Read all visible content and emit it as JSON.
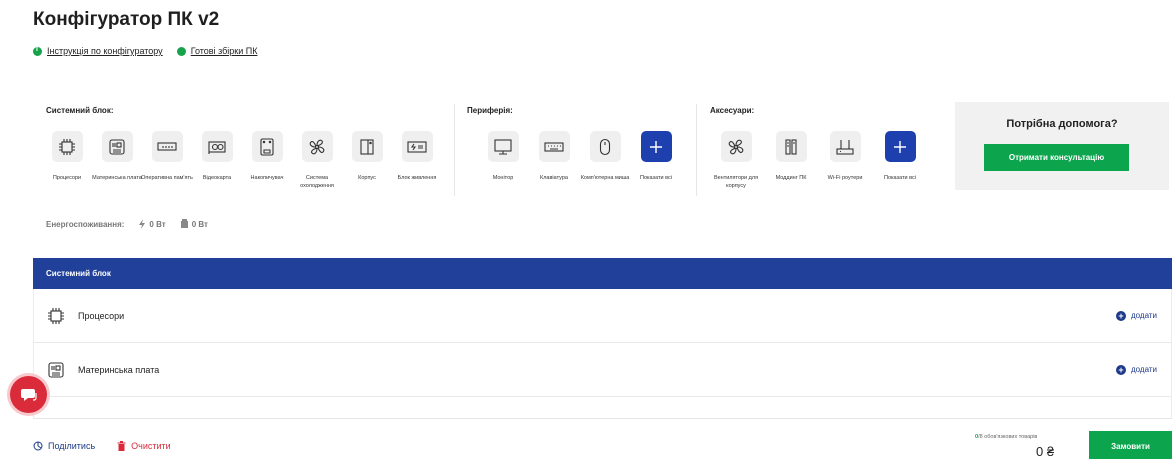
{
  "title": "Конфігуратор ПК v2",
  "links": {
    "instruction": "Інструкція по конфігуратору",
    "ready_builds": "Готові збірки ПК"
  },
  "groups": {
    "system": {
      "title": "Системний блок:",
      "items": [
        {
          "label": "Процесори",
          "icon": "cpu-icon"
        },
        {
          "label": "Материнська плата",
          "icon": "motherboard-icon"
        },
        {
          "label": "Оперативна пам'ять",
          "icon": "ram-icon"
        },
        {
          "label": "Відеокарта",
          "icon": "gpu-icon"
        },
        {
          "label": "Накопичувач",
          "icon": "storage-icon"
        },
        {
          "label": "Система охолодження",
          "icon": "fan-icon"
        },
        {
          "label": "Корпус",
          "icon": "case-icon"
        },
        {
          "label": "Блок живлення",
          "icon": "psu-icon"
        }
      ]
    },
    "periphery": {
      "title": "Периферія:",
      "items": [
        {
          "label": "Монітор",
          "icon": "monitor-icon"
        },
        {
          "label": "Клавіатура",
          "icon": "keyboard-icon"
        },
        {
          "label": "Комп'ютерна миша",
          "icon": "mouse-icon"
        },
        {
          "label": "Показати всі",
          "icon": "plus-icon"
        }
      ]
    },
    "accessories": {
      "title": "Аксесуари:",
      "items": [
        {
          "label": "Вентилятори для корпусу",
          "icon": "fan-icon"
        },
        {
          "label": "Моддинг ПК",
          "icon": "modding-icon"
        },
        {
          "label": "Wi-Fi роутери",
          "icon": "router-icon"
        },
        {
          "label": "Показати всі",
          "icon": "plus-icon"
        }
      ]
    }
  },
  "help": {
    "title": "Потрібна допомога?",
    "button": "Отримати консультацію"
  },
  "energy": {
    "label": "Енергоспоживання:",
    "power": "0 Вт",
    "psu": "0 Вт"
  },
  "section": {
    "title": "Системний блок",
    "rows": [
      {
        "label": "Процесори",
        "add": "додати"
      },
      {
        "label": "Материнська плата",
        "add": "додати"
      }
    ]
  },
  "footer": {
    "share": "Поділитись",
    "clear": "Очистити",
    "required_count": "0",
    "required_text": "/8 обов'язкових товарів",
    "total": "0 ₴",
    "order": "Замовити"
  },
  "colors": {
    "accent_green": "#0ca54e",
    "section_blue": "#20409a",
    "danger_red": "#d92b3a"
  }
}
